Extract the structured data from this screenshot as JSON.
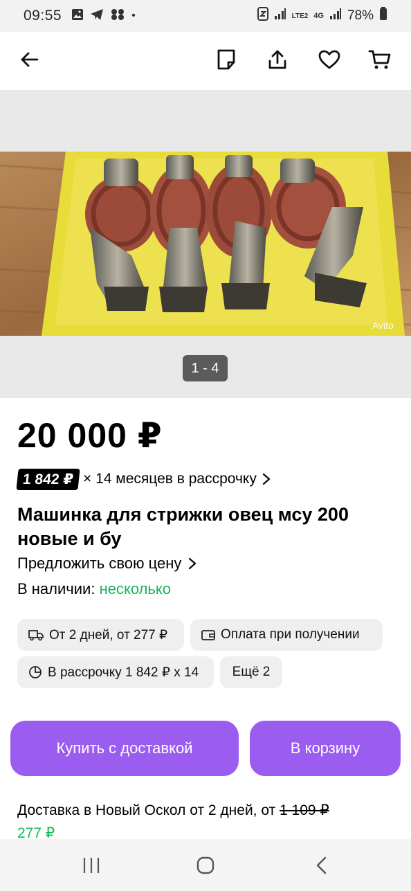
{
  "status_bar": {
    "time": "09:55",
    "dot": "•",
    "battery_percent": "78%",
    "network": "4G",
    "lte_label": "LTE2"
  },
  "app_bar": {
    "icons": [
      "back-arrow-icon",
      "notes-icon",
      "share-icon",
      "heart-icon",
      "cart-icon"
    ]
  },
  "gallery": {
    "counter": "1 - 4",
    "watermark": "Avito",
    "image_subject": "sheep shearing clippers"
  },
  "listing": {
    "price": "20 000 ₽",
    "installment_amount": "1 842 ₽",
    "installment_text": "× 14 месяцев в рассрочку",
    "title": "Машинка для стрижки овец мсу 200 новые и бу",
    "offer_price": "Предложить свою цену",
    "stock_label": "В наличии: ",
    "stock_value": "несколько",
    "stock_color": "#14b85a"
  },
  "chips": {
    "delivery": "От 2 дней, от 277 ₽",
    "payment": "Оплата при получении",
    "installment": "В рассрочку 1 842 ₽ x 14",
    "more": "Ещё 2"
  },
  "actions": {
    "buy_delivery": "Купить с доставкой",
    "to_cart": "В корзину",
    "accent_color": "#9b5cf0"
  },
  "delivery_info": {
    "text": "Доставка в Новый Оскол от 2 дней, от ",
    "old_price": "1 109 ₽",
    "new_price": "277 ₽"
  }
}
